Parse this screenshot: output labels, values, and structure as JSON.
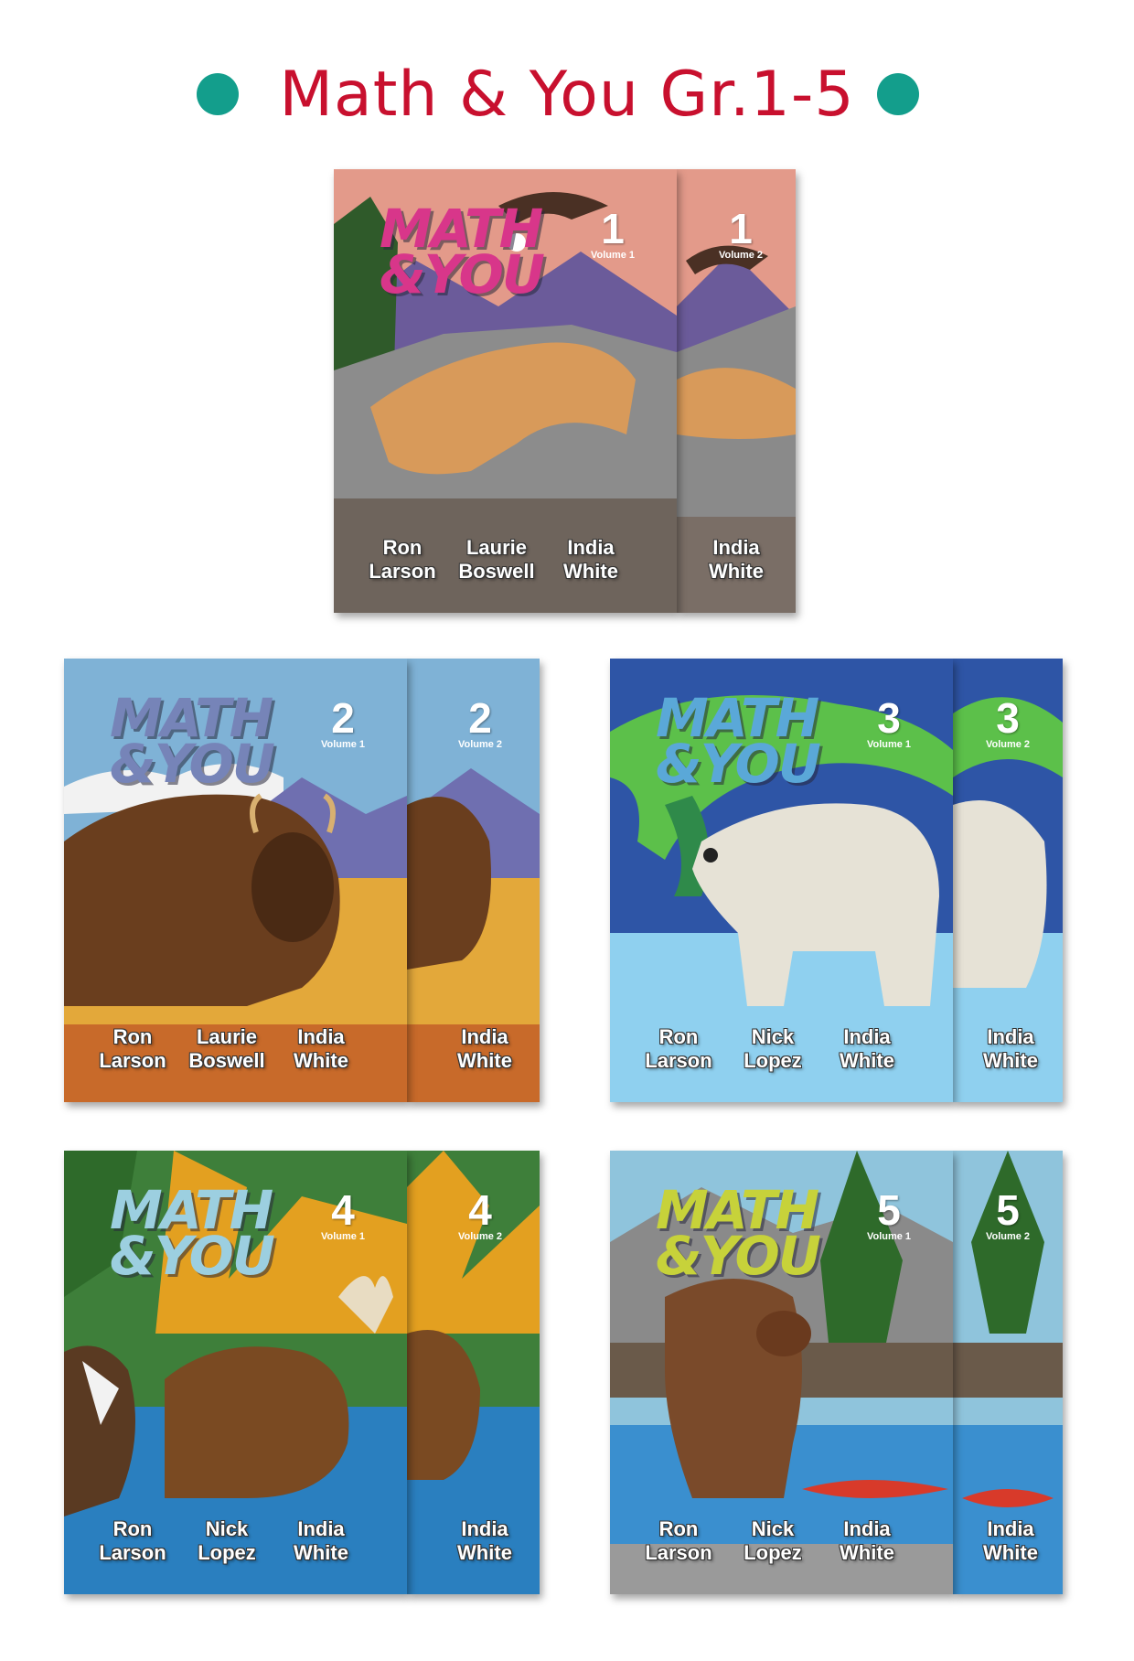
{
  "title": "Math & You Gr.1-5",
  "logo": {
    "line1": "MATH",
    "line2": "&YOU"
  },
  "grades": [
    {
      "number": "1",
      "volumes": [
        "Volume 1",
        "Volume 2"
      ],
      "animal": "mountain lion and eagle",
      "authors": [
        {
          "first": "Ron",
          "last": "Larson"
        },
        {
          "first": "Laurie",
          "last": "Boswell"
        },
        {
          "first": "India",
          "last": "White"
        }
      ],
      "colors": {
        "sky": "#e39a8a",
        "logo": "#d8368a"
      }
    },
    {
      "number": "2",
      "volumes": [
        "Volume 1",
        "Volume 2"
      ],
      "animal": "bison",
      "authors": [
        {
          "first": "Ron",
          "last": "Larson"
        },
        {
          "first": "Laurie",
          "last": "Boswell"
        },
        {
          "first": "India",
          "last": "White"
        }
      ],
      "colors": {
        "sky": "#7fb2d6",
        "logo": "#7684b8"
      }
    },
    {
      "number": "3",
      "volumes": [
        "Volume 1",
        "Volume 2"
      ],
      "animal": "polar bear",
      "authors": [
        {
          "first": "Ron",
          "last": "Larson"
        },
        {
          "first": "Nick",
          "last": "Lopez"
        },
        {
          "first": "India",
          "last": "White"
        }
      ],
      "colors": {
        "sky": "#2e55a6",
        "logo": "#5aa8d8"
      }
    },
    {
      "number": "4",
      "volumes": [
        "Volume 1",
        "Volume 2"
      ],
      "animal": "moose and osprey",
      "authors": [
        {
          "first": "Ron",
          "last": "Larson"
        },
        {
          "first": "Nick",
          "last": "Lopez"
        },
        {
          "first": "India",
          "last": "White"
        }
      ],
      "colors": {
        "sky": "#3e7f3a",
        "logo": "#9ccfe0"
      }
    },
    {
      "number": "5",
      "volumes": [
        "Volume 1",
        "Volume 2"
      ],
      "animal": "grizzly bear and salmon",
      "authors": [
        {
          "first": "Ron",
          "last": "Larson"
        },
        {
          "first": "Nick",
          "last": "Lopez"
        },
        {
          "first": "India",
          "last": "White"
        }
      ],
      "colors": {
        "sky": "#8fc4dc",
        "logo": "#c7d23a"
      }
    }
  ]
}
